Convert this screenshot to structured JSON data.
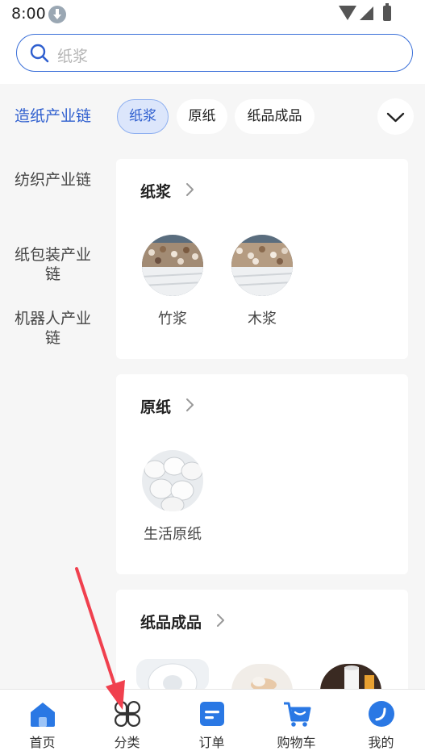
{
  "status_bar": {
    "time": "8:00"
  },
  "search": {
    "placeholder": "纸浆"
  },
  "sidebar": {
    "items": [
      {
        "label": "造纸产业链",
        "active": true
      },
      {
        "label": "纺织产业链",
        "active": false
      },
      {
        "label": "纸包装产业\n链",
        "active": false
      },
      {
        "label": "机器人产业\n链",
        "active": false
      }
    ]
  },
  "chips": [
    {
      "label": "纸浆",
      "active": true
    },
    {
      "label": "原纸",
      "active": false
    },
    {
      "label": "纸品成品",
      "active": false
    }
  ],
  "sections": [
    {
      "title": "纸浆",
      "items": [
        {
          "label": "竹浆"
        },
        {
          "label": "木浆"
        }
      ]
    },
    {
      "title": "原纸",
      "items": [
        {
          "label": "生活原纸"
        }
      ]
    },
    {
      "title": "纸品成品",
      "items": []
    }
  ],
  "bottom_nav": [
    {
      "label": "首页",
      "icon": "home-icon"
    },
    {
      "label": "分类",
      "icon": "category-icon"
    },
    {
      "label": "订单",
      "icon": "order-icon"
    },
    {
      "label": "购物车",
      "icon": "cart-icon"
    },
    {
      "label": "我的",
      "icon": "profile-icon"
    }
  ],
  "colors": {
    "accent": "#2f5fcf",
    "nav_blue": "#2a78e4",
    "annotation_arrow": "#f0404e"
  }
}
